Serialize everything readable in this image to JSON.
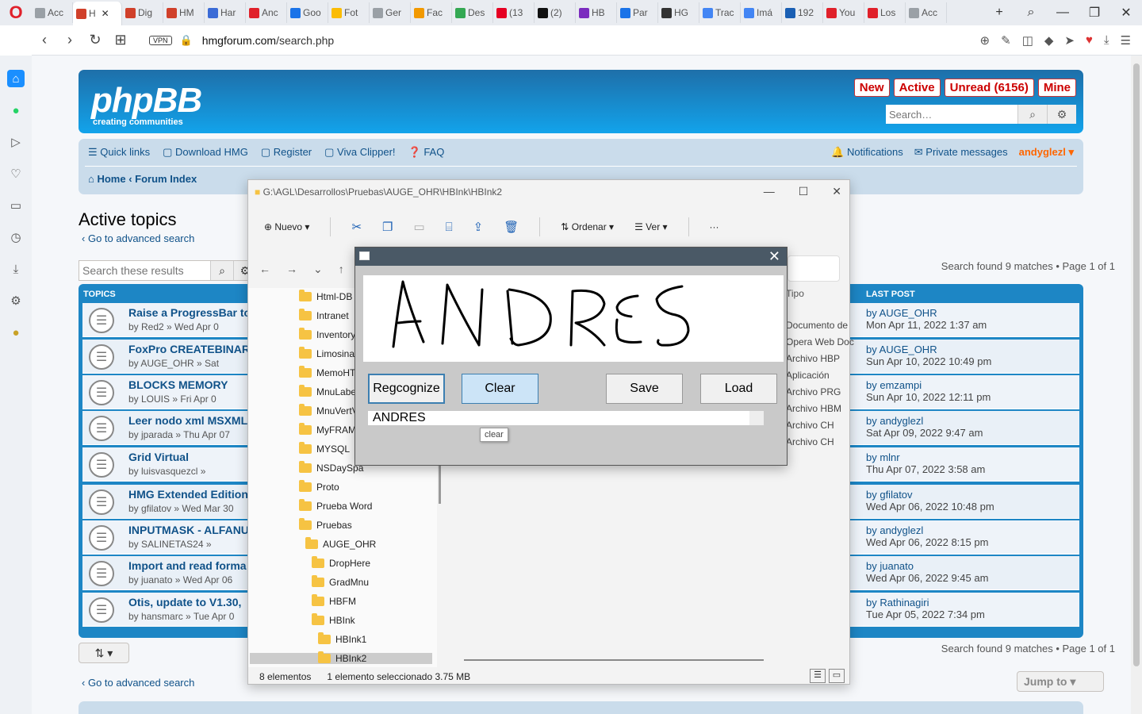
{
  "browser": {
    "logo": "O",
    "tabs": [
      {
        "label": "Acc",
        "color": "#9aa0a6"
      },
      {
        "label": "H",
        "color": "#d0402a",
        "active": true
      },
      {
        "label": "Dig",
        "color": "#d0402a"
      },
      {
        "label": "HM",
        "color": "#d0402a"
      },
      {
        "label": "Har",
        "color": "#3b6bd6"
      },
      {
        "label": "Anc",
        "color": "#e0202a"
      },
      {
        "label": "Goo",
        "color": "#1a73e8"
      },
      {
        "label": "Fot",
        "color": "#fbbc04"
      },
      {
        "label": "Ger",
        "color": "#9aa0a6"
      },
      {
        "label": "Fac",
        "color": "#f29900"
      },
      {
        "label": "Des",
        "color": "#34a853"
      },
      {
        "label": "(13",
        "color": "#e60023"
      },
      {
        "label": "(2)",
        "color": "#111"
      },
      {
        "label": "HB",
        "color": "#7b2cbf"
      },
      {
        "label": "Par",
        "color": "#1a73e8"
      },
      {
        "label": "HG",
        "color": "#333"
      },
      {
        "label": "Trac",
        "color": "#4285f4"
      },
      {
        "label": "Imá",
        "color": "#4285f4"
      },
      {
        "label": "192",
        "color": "#1a5fb4"
      },
      {
        "label": "You",
        "color": "#e0202a"
      },
      {
        "label": "Los",
        "color": "#e0202a"
      },
      {
        "label": "Acc",
        "color": "#9aa0a6"
      }
    ],
    "url_host": "hmgforum.com",
    "url_path": "/search.php",
    "vpn": "VPN"
  },
  "forum": {
    "quick_buttons": [
      "New",
      "Active",
      "Unread (6156)",
      "Mine"
    ],
    "search_placeholder": "Search…",
    "nav_left": [
      "Quick links",
      "Download HMG",
      "Register",
      "Viva Clipper!",
      "FAQ"
    ],
    "notifications": "Notifications",
    "private_messages": "Private messages",
    "username": "andyglezl",
    "crumb_home": "Home",
    "crumb_index": "Forum Index",
    "title": "Active topics",
    "advanced_search": "Go to advanced search",
    "search_results_placeholder": "Search these results",
    "pageinfo": "Search found 9 matches • Page 1 of 1",
    "col_topics": "TOPICS",
    "col_last_post": "LAST POST",
    "jump_to": "Jump to",
    "topics": [
      {
        "title": "Raise a ProgressBar to",
        "by": "by Red2 » Wed Apr 0",
        "lp_user": "by AUGE_OHR",
        "lp_date": "Mon Apr 11, 2022 1:37 am"
      },
      {
        "title": "FoxPro CREATEBINARY",
        "by": "by AUGE_OHR » Sat",
        "lp_user": "by AUGE_OHR",
        "lp_date": "Sun Apr 10, 2022 10:49 pm"
      },
      {
        "title": "BLOCKS MEMORY",
        "by": "by LOUIS » Fri Apr 0",
        "lp_user": "by emzampi",
        "lp_date": "Sun Apr 10, 2022 12:11 pm"
      },
      {
        "title": "Leer nodo xml MSXML",
        "by": "by jparada » Thu Apr 07",
        "lp_user": "by andyglezl",
        "lp_date": "Sat Apr 09, 2022 9:47 am"
      },
      {
        "title": "Grid Virtual",
        "by": "by luisvasquezcl »",
        "lp_user": "by mlnr",
        "lp_date": "Thu Apr 07, 2022 3:58 am"
      },
      {
        "title": "HMG Extended Edition",
        "by": "by gfilatov » Wed Mar 30",
        "lp_user": "by gfilatov",
        "lp_date": "Wed Apr 06, 2022 10:48 pm"
      },
      {
        "title": "INPUTMASK - ALFANUM",
        "by": "by SALINETAS24 »",
        "lp_user": "by andyglezl",
        "lp_date": "Wed Apr 06, 2022 8:15 pm"
      },
      {
        "title": "Import and read forma",
        "by": "by juanato » Wed Apr 06",
        "lp_user": "by juanato",
        "lp_date": "Wed Apr 06, 2022 9:45 am"
      },
      {
        "title": "Otis, update to V1.30,",
        "by": "by hansmarc » Tue Apr 0",
        "lp_user": "by Rathinagiri",
        "lp_date": "Tue Apr 05, 2022 7:34 pm"
      }
    ]
  },
  "explorer": {
    "path": "G:\\AGL\\Desarrollos\\Pruebas\\AUGE_OHR\\HBInk\\HBInk2",
    "new_label": "Nuevo",
    "sort_label": "Ordenar",
    "view_label": "Ver",
    "more": "···",
    "tree": [
      "Html-DB",
      "Intranet",
      "Inventory",
      "Limosina",
      "MemoHT",
      "MnuLabe",
      "MnuVertV",
      "MyFRAM",
      "MYSQL",
      "NSDaySpa",
      "Proto",
      "Prueba Word",
      "Pruebas",
      "AUGE_OHR",
      "DropHere",
      "GradMnu",
      "HBFM",
      "HBInk",
      "HBInk1",
      "HBInk2"
    ],
    "col_type": "Tipo",
    "types": [
      "Documento de",
      "Opera Web Doc",
      "Archivo HBP",
      "Aplicación",
      "Archivo PRG",
      "Archivo HBM",
      "Archivo CH",
      "Archivo CH"
    ],
    "status_count": "8 elementos",
    "status_sel": "1 elemento seleccionado  3.75 MB"
  },
  "ink": {
    "buttons": [
      "Regcognize",
      "Clear",
      "Save",
      "Load"
    ],
    "result": "ANDRES",
    "tooltip": "clear"
  }
}
